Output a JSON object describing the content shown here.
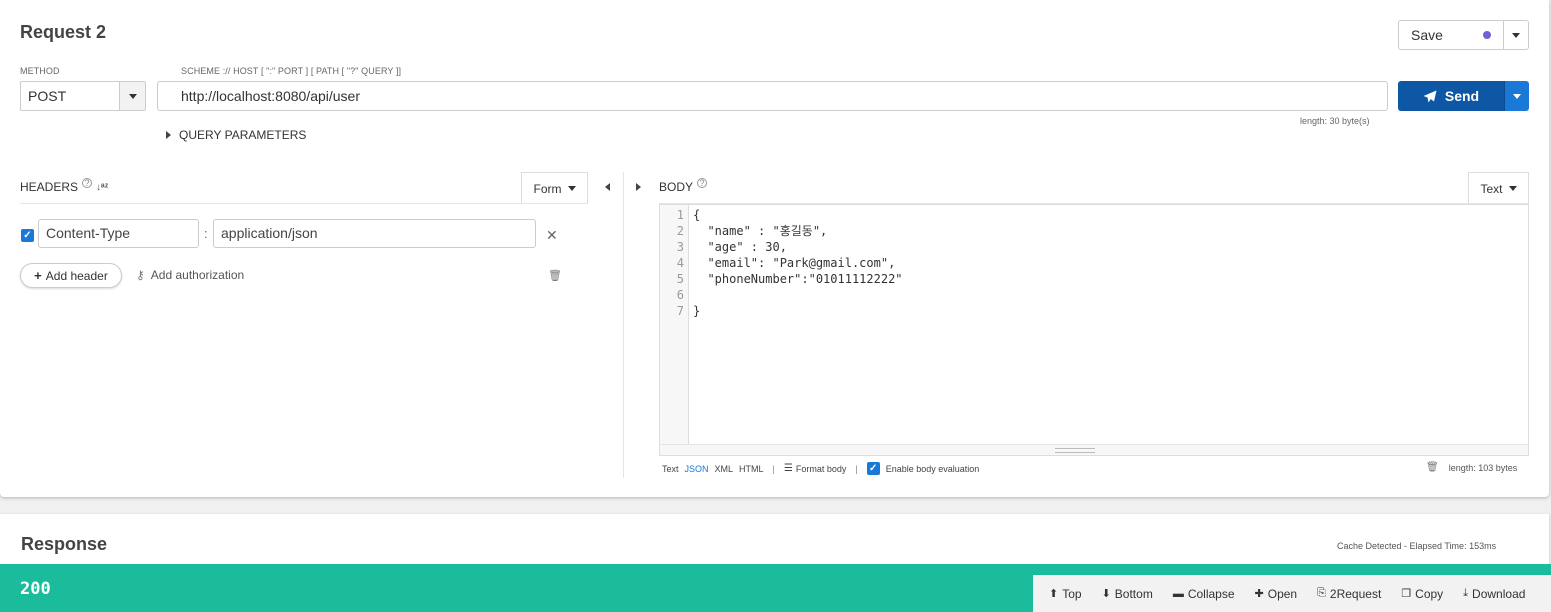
{
  "request": {
    "title": "Request 2",
    "save_label": "Save",
    "method_label": "METHOD",
    "method_value": "POST",
    "url_label": "SCHEME :// HOST [ \":\" PORT ] [ PATH [ \"?\" QUERY ]]",
    "url_value": "http://localhost:8080/api/user",
    "send_label": "Send",
    "url_length": "length: 30 byte(s)",
    "query_params_label": "QUERY PARAMETERS"
  },
  "headers": {
    "label": "HEADERS",
    "help": "?",
    "sort_icon": "sort-alpha-icon",
    "mode_label": "Form",
    "items": [
      {
        "enabled": true,
        "name": "Content-Type",
        "value": "application/json"
      }
    ],
    "add_header_label": "Add header",
    "add_auth_label": "Add authorization"
  },
  "body": {
    "label": "BODY",
    "help": "?",
    "mode_label": "Text",
    "lines": [
      {
        "n": "1",
        "text": "{"
      },
      {
        "n": "2",
        "text": "  \"name\" : \"홍길동\","
      },
      {
        "n": "3",
        "text": "  \"age\" : 30,"
      },
      {
        "n": "4",
        "text": "  \"email\": \"Park@gmail.com\","
      },
      {
        "n": "5",
        "text": "  \"phoneNumber\":\"01011112222\""
      },
      {
        "n": "6",
        "text": ""
      },
      {
        "n": "7",
        "text": "}"
      }
    ],
    "formats": [
      "Text",
      "JSON",
      "XML",
      "HTML"
    ],
    "selected_format": "JSON",
    "format_body_label": "Format body",
    "enable_eval_label": "Enable body evaluation",
    "length": "length: 103 bytes"
  },
  "response": {
    "title": "Response",
    "cache_info": "Cache Detected - Elapsed Time: 153ms",
    "status_code": "200",
    "status_color": "#1abc9c",
    "tools": [
      {
        "icon": "arrow-up-circle-icon",
        "glyph": "⬆",
        "label": "Top"
      },
      {
        "icon": "arrow-down-circle-icon",
        "glyph": "⬇",
        "label": "Bottom"
      },
      {
        "icon": "minus-square-icon",
        "glyph": "▬",
        "label": "Collapse"
      },
      {
        "icon": "plus-square-icon",
        "glyph": "✚",
        "label": "Open"
      },
      {
        "icon": "copy-doc-icon",
        "glyph": "⎘",
        "label": "2Request"
      },
      {
        "icon": "copy-icon",
        "glyph": "❐",
        "label": "Copy"
      },
      {
        "icon": "download-icon",
        "glyph": "⤓",
        "label": "Download"
      }
    ]
  },
  "colors": {
    "send": "#0d57a4",
    "accent": "#1a78d6",
    "save_dot": "#6c63d6"
  }
}
